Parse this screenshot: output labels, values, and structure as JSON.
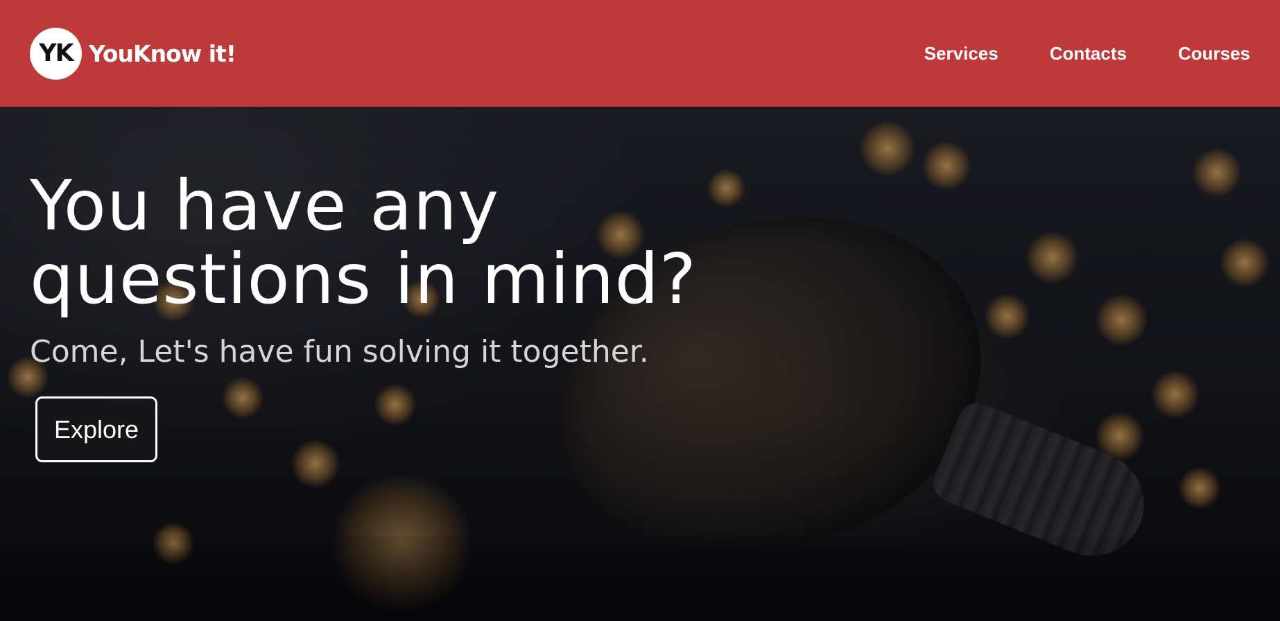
{
  "header": {
    "logo_initials": "YK",
    "brand_name": "YouKnow it!",
    "nav": [
      {
        "label": "Services"
      },
      {
        "label": "Contacts"
      },
      {
        "label": "Courses"
      }
    ]
  },
  "hero": {
    "headline_line1": "You have any",
    "headline_line2": "questions in mind?",
    "subheadline": "Come, Let's have fun solving it together.",
    "cta_label": "Explore"
  },
  "colors": {
    "header_bg": "#be3939",
    "text": "#ffffff"
  },
  "icons": {
    "logo": "yk-logo-badge"
  }
}
